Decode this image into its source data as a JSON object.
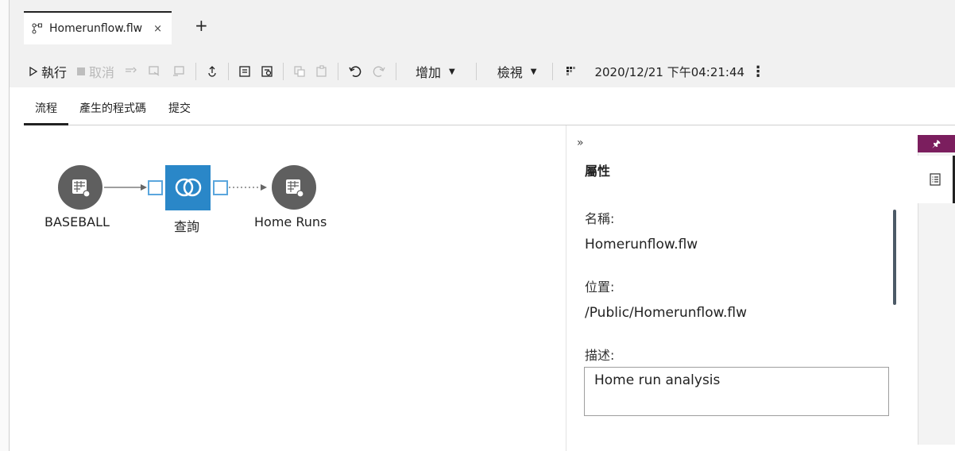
{
  "tab": {
    "title": "Homerunflow.flw",
    "close": "×",
    "add": "+"
  },
  "toolbar": {
    "run_label": "執行",
    "cancel_label": "取消",
    "add_label": "增加",
    "view_label": "檢視",
    "timestamp": "2020/12/21 下午04:21:44",
    "more": "⋮"
  },
  "subtabs": [
    "流程",
    "產生的程式碼",
    "提交"
  ],
  "flow": {
    "nodes": [
      {
        "label": "BASEBALL",
        "kind": "table"
      },
      {
        "label": "查詢",
        "kind": "query"
      },
      {
        "label": "Home Runs",
        "kind": "table"
      }
    ]
  },
  "properties": {
    "collapse": "»",
    "title": "屬性",
    "name_label": "名稱:",
    "name_value": "Homerunflow.flw",
    "location_label": "位置:",
    "location_value": "/Public/Homerunflow.flw",
    "description_label": "描述:",
    "description_value": "Home run analysis"
  },
  "rail": {
    "pin": "🖈"
  },
  "colors": {
    "query_node": "#2a87c8",
    "table_node": "#5f5f5f",
    "pin_bar": "#7b1e5e",
    "port_border": "#5aa6dd"
  }
}
